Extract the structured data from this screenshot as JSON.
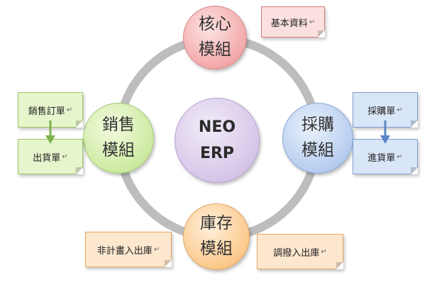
{
  "diagram": {
    "center": {
      "line1": "NEO",
      "line2": "ERP"
    },
    "modules": {
      "core": "核心模組",
      "sales": "銷售模組",
      "purchasing": "採購模組",
      "inventory": "庫存模組"
    },
    "notes": {
      "basic_data": "基本資料",
      "sales_order": "銷售訂單",
      "shipment": "出貨單",
      "purchase_order": "採購單",
      "goods_receipt": "進貨單",
      "misc_in_out": "非計畫入出庫",
      "transfer_in_out": "調撥入出庫",
      "paragraph_mark": "↵"
    },
    "colors": {
      "ring": "#bdbdbd",
      "core": "#f3a9a9",
      "sales": "#cdeaa1",
      "purchasing": "#b7cdef",
      "inventory": "#fbc98c",
      "center": "#d6c6e8",
      "arrow_green": "#7fb24a",
      "arrow_blue": "#5a86c6"
    }
  }
}
